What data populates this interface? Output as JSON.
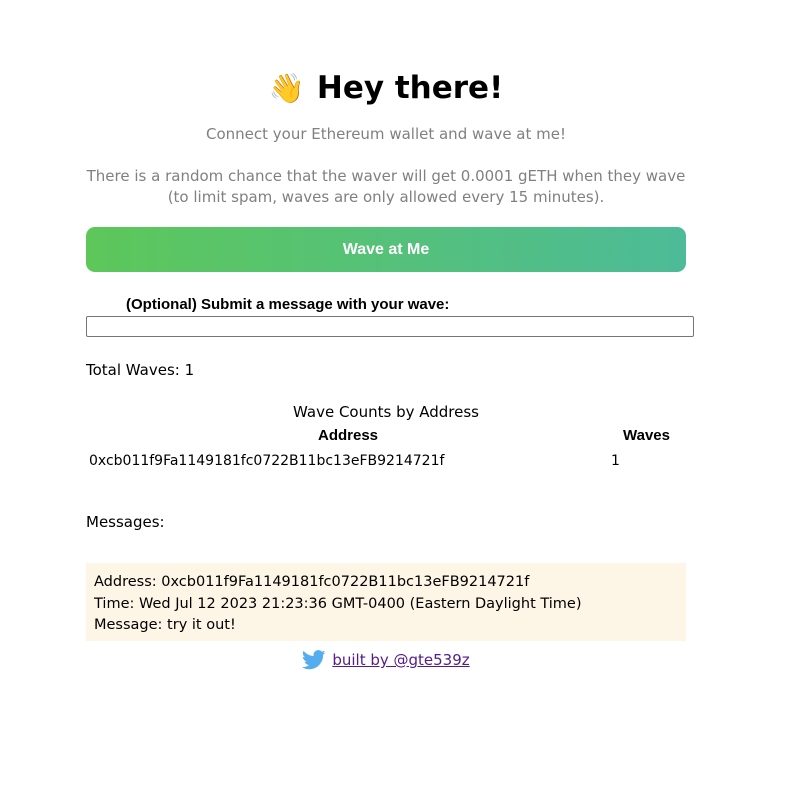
{
  "header": {
    "emoji": "👋",
    "title": "Hey there!"
  },
  "intro": {
    "subtitle": "Connect your Ethereum wallet and wave at me!",
    "note": "There is a random chance that the waver will get 0.0001 gETH when they wave (to limit spam, waves are only allowed every 15 minutes)."
  },
  "actions": {
    "wave_button_label": "Wave at Me",
    "message_label": "(Optional) Submit a message with your wave:",
    "message_value": ""
  },
  "stats": {
    "total_waves": "Total Waves: 1"
  },
  "wave_counts": {
    "title": "Wave Counts by Address",
    "columns": [
      "Address",
      "Waves"
    ],
    "rows": [
      {
        "address": "0xcb011f9Fa1149181fc0722B11bc13eFB9214721f",
        "waves": "1"
      }
    ]
  },
  "messages": {
    "label": "Messages:",
    "items": [
      {
        "address": "Address: 0xcb011f9Fa1149181fc0722B11bc13eFB9214721f",
        "time": "Time: Wed Jul 12 2023 21:23:36 GMT-0400 (Eastern Daylight Time)",
        "message": "Message: try it out!"
      }
    ]
  },
  "footer": {
    "icon": "twitter-icon",
    "link_text": "built by @gte539z",
    "icon_color": "#55acee"
  },
  "colors": {
    "button_gradient_start": "#5dc75a",
    "button_gradient_end": "#4dbb98",
    "message_bg": "#fdf5e6",
    "muted_text": "#808080",
    "link": "#551a8b"
  }
}
